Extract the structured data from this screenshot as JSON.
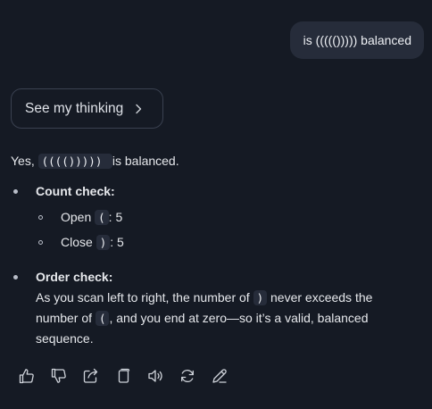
{
  "user_message": "is ((((())))) balanced",
  "thinking_button": {
    "label": "See my thinking"
  },
  "answer": {
    "intro_prefix": "Yes,",
    "intro_code": "(((())))) ",
    "intro_suffix": "is balanced.",
    "count_check": {
      "title": "Count check:",
      "open_label": "Open",
      "open_symbol": "(",
      "open_value": ": 5",
      "close_label": "Close",
      "close_symbol": ")",
      "close_value": ": 5"
    },
    "order_check": {
      "title": "Order check:",
      "line1_prefix": "As you scan left to right, the number of",
      "line1_symbol": ")",
      "line1_suffix": "never exceeds the",
      "line2_prefix": "number of",
      "line2_symbol": "(",
      "line2_suffix": ", and you end at zero—so it’s a valid, balanced",
      "line3": "sequence."
    }
  },
  "actions": [
    {
      "name": "thumbs-up-icon"
    },
    {
      "name": "thumbs-down-icon"
    },
    {
      "name": "share-icon"
    },
    {
      "name": "copy-icon"
    },
    {
      "name": "speaker-icon"
    },
    {
      "name": "regenerate-icon"
    },
    {
      "name": "edit-icon"
    }
  ]
}
